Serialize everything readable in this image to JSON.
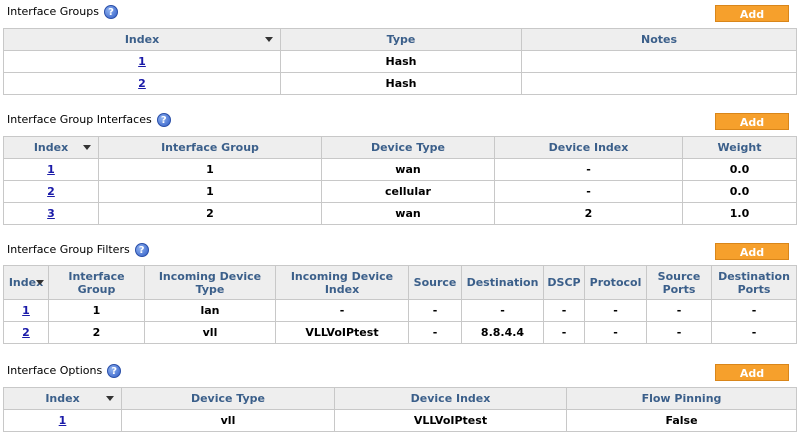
{
  "groups": {
    "title": "Interface Groups",
    "help_icon": "?",
    "add_label": "Add",
    "columns": [
      "Index",
      "Type",
      "Notes"
    ],
    "rows": [
      {
        "index": "1",
        "type": "Hash",
        "notes": ""
      },
      {
        "index": "2",
        "type": "Hash",
        "notes": ""
      }
    ]
  },
  "group_interfaces": {
    "title": "Interface Group Interfaces",
    "help_icon": "?",
    "add_label": "Add",
    "columns": [
      "Index",
      "Interface Group",
      "Device Type",
      "Device Index",
      "Weight"
    ],
    "rows": [
      {
        "index": "1",
        "group": "1",
        "device_type": "wan",
        "device_index": "-",
        "weight": "0.0"
      },
      {
        "index": "2",
        "group": "1",
        "device_type": "cellular",
        "device_index": "-",
        "weight": "0.0"
      },
      {
        "index": "3",
        "group": "2",
        "device_type": "wan",
        "device_index": "2",
        "weight": "1.0"
      }
    ]
  },
  "group_filters": {
    "title": "Interface Group Filters",
    "help_icon": "?",
    "add_label": "Add",
    "columns": [
      "Index",
      "Interface Group",
      "Incoming Device Type",
      "Incoming Device Index",
      "Source",
      "Destination",
      "DSCP",
      "Protocol",
      "Source Ports",
      "Destination Ports"
    ],
    "rows": [
      {
        "index": "1",
        "group": "1",
        "in_type": "lan",
        "in_index": "-",
        "source": "-",
        "destination": "-",
        "dscp": "-",
        "protocol": "-",
        "src_ports": "-",
        "dst_ports": "-"
      },
      {
        "index": "2",
        "group": "2",
        "in_type": "vll",
        "in_index": "VLLVoIPtest",
        "source": "-",
        "destination": "8.8.4.4",
        "dscp": "-",
        "protocol": "-",
        "src_ports": "-",
        "dst_ports": "-"
      }
    ]
  },
  "options": {
    "title": "Interface Options",
    "help_icon": "?",
    "add_label": "Add",
    "columns": [
      "Index",
      "Device Type",
      "Device Index",
      "Flow Pinning"
    ],
    "rows": [
      {
        "index": "1",
        "device_type": "vll",
        "device_index": "VLLVoIPtest",
        "flow_pinning": "False"
      }
    ]
  }
}
